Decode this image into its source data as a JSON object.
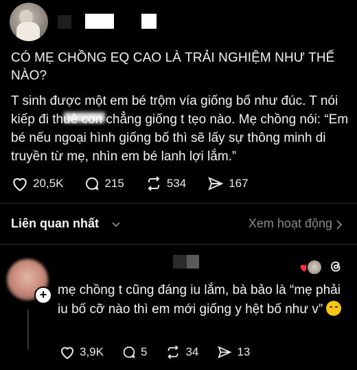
{
  "post": {
    "title": "CÓ MẸ CHỒNG EQ CAO LÀ TRẢI NGHIỆM NHƯ THẾ NÀO?",
    "body": "T sinh được một em bé trộm vía giống bố như đúc. T nói kiếp đi thuê con chẳng giống t tẹo nào. Mẹ chồng nói: “Em bé nếu ngoại hình giống bố thì sẽ lấy sự thông minh di truyền từ mẹ, nhìn em bé lanh lợi lắm.”",
    "likes": "20,5K",
    "comments": "215",
    "reposts": "534",
    "shares": "167"
  },
  "sort": {
    "label": "Liên quan nhất",
    "activity": "Xem hoạt động"
  },
  "reply": {
    "text": "mẹ chồng t cũng đáng iu lắm, bà bảo là “mẹ phải iu bố cỡ nào thì em mới giống y hệt bố như v”",
    "likes": "3,9K",
    "comments": "5",
    "reposts": "34",
    "shares": "13"
  },
  "icons": {
    "like": "heart-icon",
    "comment": "comment-bubble-icon",
    "repost": "repost-icon",
    "share": "send-icon",
    "threads": "threads-logo-icon",
    "follow": "plus-icon"
  },
  "colors": {
    "background": "#000000",
    "text": "#f3f3f3",
    "muted": "#8a8a8a",
    "heart": "#ff3040"
  }
}
